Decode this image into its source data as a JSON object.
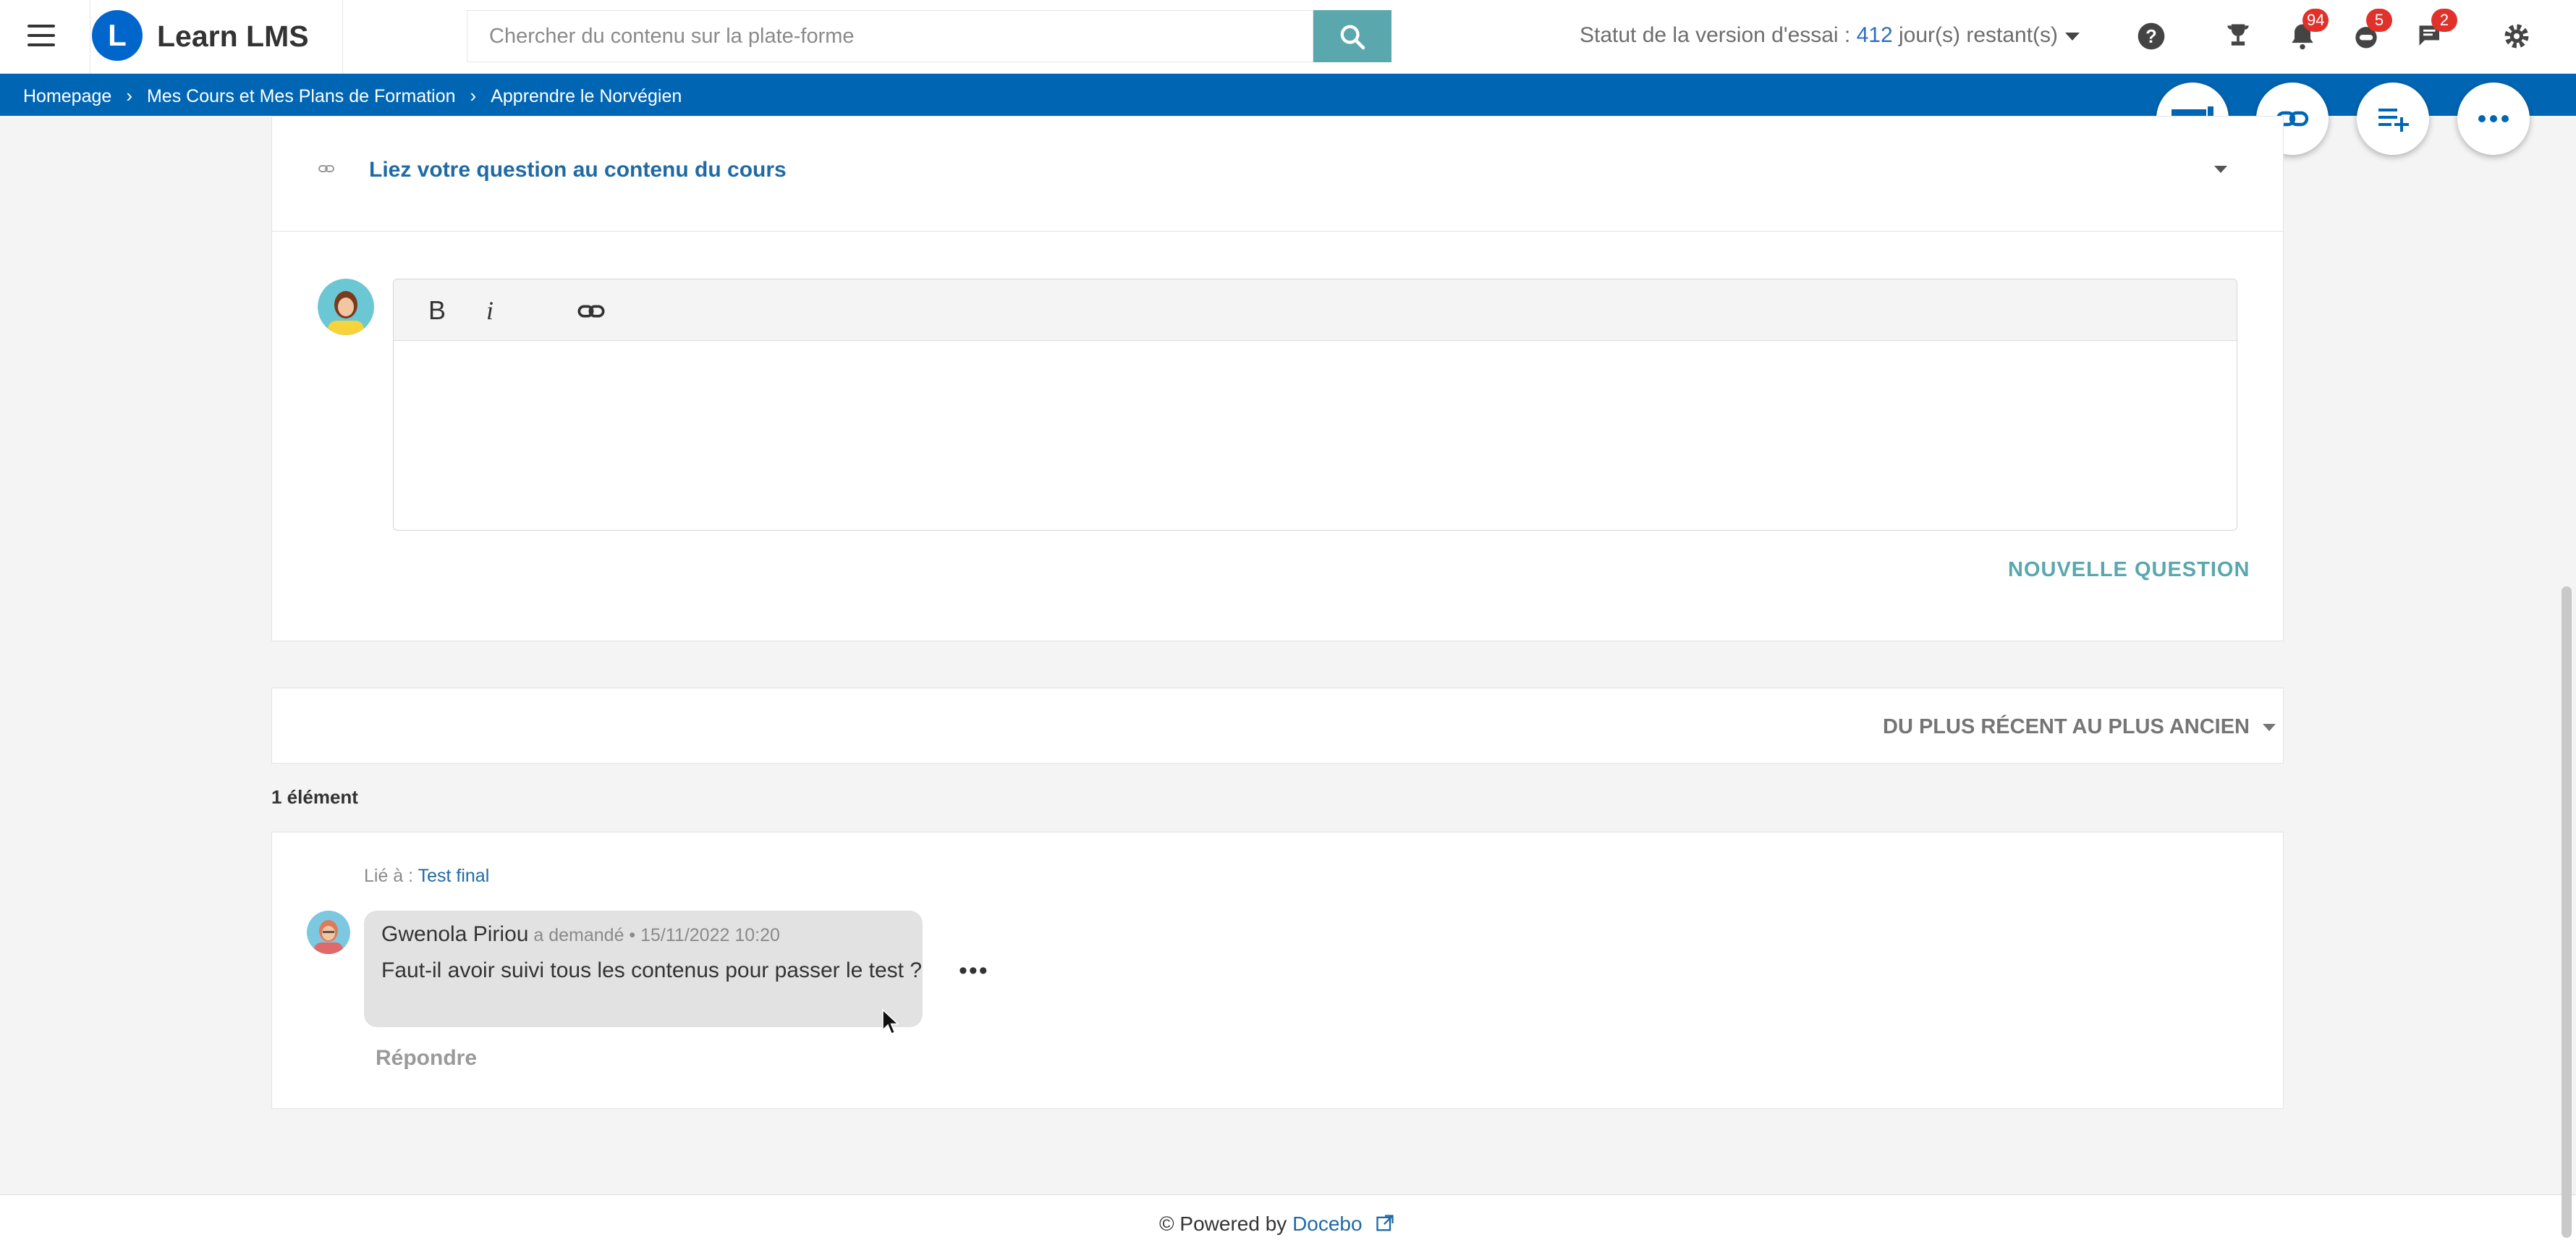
{
  "app": {
    "brand": "Learn LMS",
    "logo_letter": "L"
  },
  "search": {
    "placeholder": "Chercher du contenu sur la plate-forme"
  },
  "trial": {
    "prefix": "Statut de la version d'essai : ",
    "days": "412",
    "suffix": " jour(s) restant(s)"
  },
  "header_icons": {
    "notifications_badge": "94",
    "chat_badge": "5",
    "messages_badge": "2"
  },
  "breadcrumb": [
    "Homepage",
    "Mes Cours et Mes Plans de Formation",
    "Apprendre le Norvégien"
  ],
  "question_form": {
    "link_title": "Liez votre question au contenu du cours",
    "bold_label": "B",
    "italic_label": "i",
    "submit_label": "NOUVELLE QUESTION"
  },
  "sort": {
    "label": "DU PLUS RÉCENT AU PLUS ANCIEN"
  },
  "results": {
    "count_label": "1 élément"
  },
  "thread": {
    "linked_prefix": "Lié à : ",
    "linked_target": "Test final",
    "author": "Gwenola Piriou",
    "meta": " a demandé • 15/11/2022 10:20",
    "text": "Faut-il avoir suivi tous les contenus pour passer le test ?",
    "more_label": "•••",
    "reply_label": "Répondre"
  },
  "footer": {
    "prefix": "© Powered by ",
    "link": "Docebo"
  },
  "colors": {
    "primary": "#0066b3",
    "accent": "#5aa7ad",
    "badge": "#e0322b",
    "link": "#1f6aa5"
  }
}
